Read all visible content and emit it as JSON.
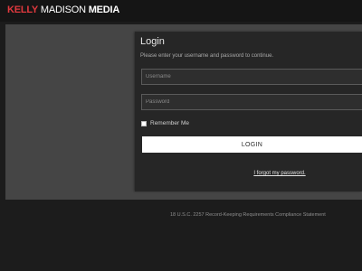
{
  "brand": {
    "part1": "KELLY",
    "part2": " MADISON",
    "part3": " MEDIA",
    "accent_color": "#e0393e"
  },
  "login": {
    "title": "Login",
    "subtitle": "Please enter your username and password to continue.",
    "username_placeholder": "Username",
    "password_placeholder": "Password",
    "remember_label": "Remember Me",
    "button_label": "LOGIN",
    "forgot_label": "I forgot my password."
  },
  "footer": {
    "compliance": "18 U.S.C. 2257 Record-Keeping Requirements Compliance Statement"
  }
}
